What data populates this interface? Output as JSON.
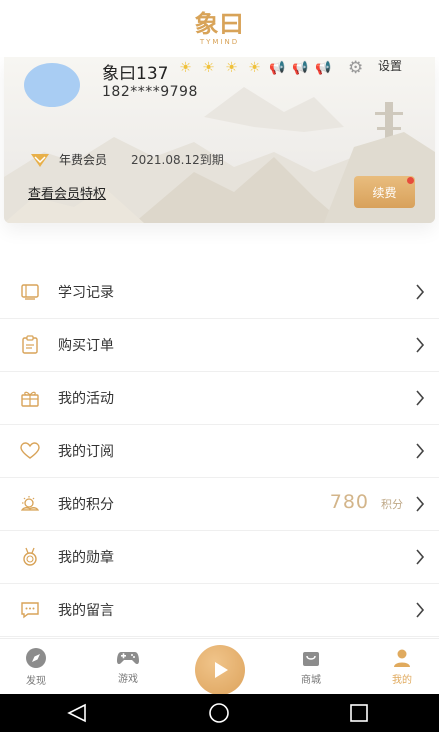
{
  "header": {
    "logo_text": "象曰",
    "logo_sub": "TYMIND"
  },
  "profile": {
    "username": "象曰137",
    "phone": "182****9798",
    "settings_label": "设置",
    "weather_icons": [
      "sun-icon",
      "sun-icon",
      "sun-icon",
      "sun-icon",
      "horn-icon",
      "horn-icon",
      "horn-icon"
    ],
    "membership": {
      "type": "年费会员",
      "expiry": "2021.08.12到期",
      "privileges_link": "查看会员特权",
      "renew_button": "续费"
    }
  },
  "menu": {
    "items": [
      {
        "label": "学习记录",
        "icon": "book-icon"
      },
      {
        "label": "购买订单",
        "icon": "clipboard-icon"
      },
      {
        "label": "我的活动",
        "icon": "gift-icon"
      },
      {
        "label": "我的订阅",
        "icon": "heart-icon"
      },
      {
        "label": "我的积分",
        "icon": "sun-cloud-icon",
        "value": "780",
        "unit": "积分"
      },
      {
        "label": "我的勋章",
        "icon": "medal-icon"
      },
      {
        "label": "我的留言",
        "icon": "message-icon"
      }
    ]
  },
  "tabs": [
    {
      "label": "发现",
      "icon": "compass-icon"
    },
    {
      "label": "游戏",
      "icon": "gamepad-icon"
    },
    {
      "label": "",
      "icon": "play-icon"
    },
    {
      "label": "商城",
      "icon": "shopping-bag-icon"
    },
    {
      "label": "我的",
      "icon": "user-icon",
      "active": true
    }
  ],
  "colors": {
    "accent": "#dda35c",
    "avatar": "#a9cdf3",
    "points": "#d3b58a",
    "badge": "#e74c3c"
  }
}
